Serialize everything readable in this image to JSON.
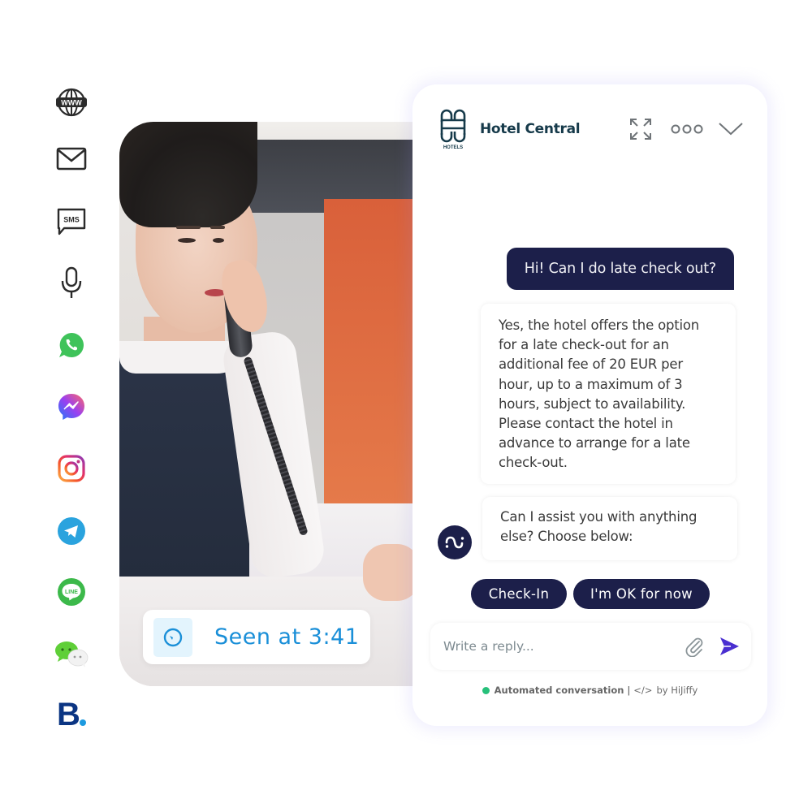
{
  "channels": [
    {
      "name": "website",
      "icon": "globe-www-icon",
      "label": "WWW"
    },
    {
      "name": "email",
      "icon": "envelope-icon"
    },
    {
      "name": "sms",
      "icon": "sms-bubble-icon",
      "label": "SMS"
    },
    {
      "name": "voice",
      "icon": "microphone-icon"
    },
    {
      "name": "whatsapp",
      "icon": "whatsapp-icon",
      "color": "#3fc35a"
    },
    {
      "name": "messenger",
      "icon": "messenger-icon",
      "color": "#9b4ff0"
    },
    {
      "name": "instagram",
      "icon": "instagram-icon",
      "color": "#e1306c"
    },
    {
      "name": "telegram",
      "icon": "telegram-icon",
      "color": "#2aa3de"
    },
    {
      "name": "line",
      "icon": "line-icon",
      "color": "#3cb94a",
      "label": "LINE"
    },
    {
      "name": "wechat",
      "icon": "wechat-icon",
      "color": "#5fcf38"
    },
    {
      "name": "booking",
      "icon": "booking-com-icon",
      "color": "#0b3583",
      "label": "B"
    }
  ],
  "photo": {
    "description": "hotel receptionist on phone"
  },
  "seen_badge": {
    "icon": "clock-icon",
    "text": "Seen at 3:41",
    "color": "#1a8fd8"
  },
  "chat": {
    "header": {
      "logo_caption": "HOTELS",
      "title": "Hotel Central",
      "expand_icon": "expand-icon",
      "more_icon": "more-options-icon",
      "collapse_icon": "chevron-down-icon"
    },
    "messages": [
      {
        "sender": "user",
        "text": "Hi! Can I do late check out?"
      },
      {
        "sender": "bot",
        "text": "Yes, the hotel offers the option for a late check-out for an additional fee of 20 EUR per hour, up to a maximum of 3 hours, subject to availability. Please contact the hotel in advance to arrange for a late check-out."
      },
      {
        "sender": "bot",
        "text": "Can I assist you with anything else? Choose below:"
      }
    ],
    "quick_replies": [
      "Check-In",
      "I'm OK for now"
    ],
    "composer": {
      "placeholder": "Write a reply...",
      "attach_icon": "paperclip-icon",
      "send_icon": "send-icon"
    },
    "footer": {
      "status_text": "Automated conversation",
      "separator": "|",
      "code_glyph": "</>",
      "by_text": "by HiJiffy",
      "status_color": "#27c07a"
    },
    "colors": {
      "primary": "#1c1f4a",
      "send": "#4a2fd0",
      "brand_text": "#163a4a"
    }
  }
}
